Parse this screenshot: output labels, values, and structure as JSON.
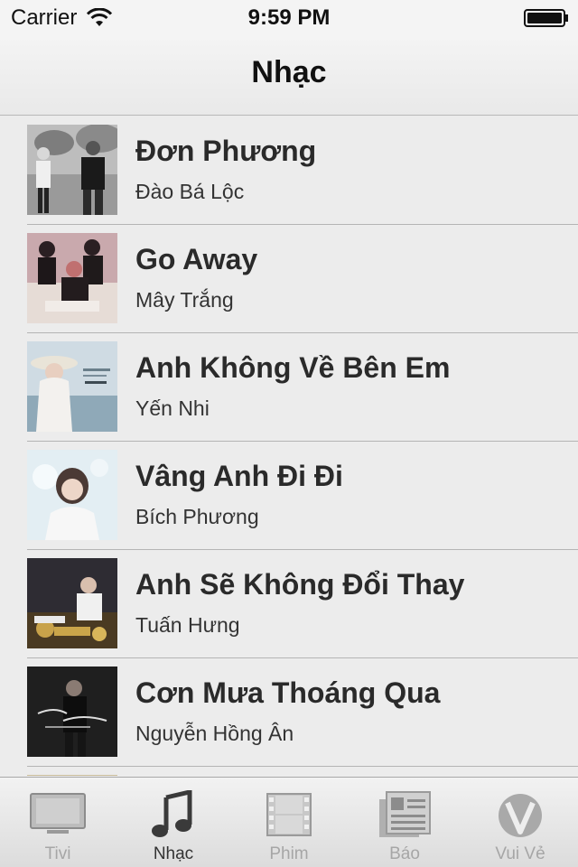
{
  "status_bar": {
    "carrier": "Carrier",
    "time": "9:59 PM"
  },
  "nav": {
    "title": "Nhạc"
  },
  "songs": [
    {
      "title": "Đơn Phương",
      "artist": "Đào Bá Lộc",
      "cover_icon": "album-cover-bw-couple"
    },
    {
      "title": "Go Away",
      "artist": "Mây Trắng",
      "cover_icon": "album-cover-three-singers"
    },
    {
      "title": "Anh Không Về Bên Em",
      "artist": "Yến Nhi",
      "cover_icon": "album-cover-woman-hat"
    },
    {
      "title": "Vâng Anh Đi Đi",
      "artist": "Bích Phương",
      "cover_icon": "album-cover-woman-white"
    },
    {
      "title": "Anh Sẽ Không Đổi Thay",
      "artist": "Tuấn Hưng",
      "cover_icon": "album-cover-man-gold"
    },
    {
      "title": "Cơn Mưa Thoáng Qua",
      "artist": "Nguyễn Hồng Ân",
      "cover_icon": "album-cover-man-dark"
    }
  ],
  "tabs": [
    {
      "label": "Tivi",
      "icon": "tv-icon",
      "active": false
    },
    {
      "label": "Nhạc",
      "icon": "music-note-icon",
      "active": true
    },
    {
      "label": "Phim",
      "icon": "film-icon",
      "active": false
    },
    {
      "label": "Báo",
      "icon": "newspaper-icon",
      "active": false
    },
    {
      "label": "Vui Vẻ",
      "icon": "v-logo-icon",
      "active": false
    }
  ],
  "colors": {
    "background": "#ececec",
    "tab_inactive": "#a6a6a6",
    "tab_active": "#333333",
    "separator": "#b4b4b4"
  }
}
